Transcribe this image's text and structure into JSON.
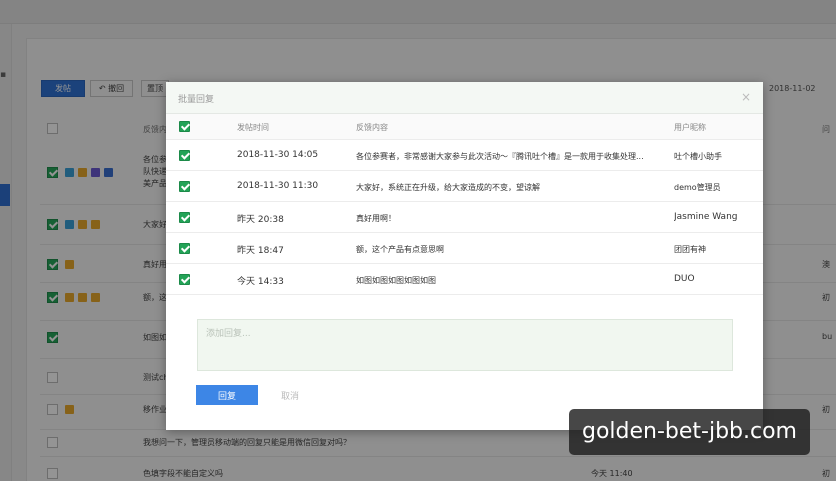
{
  "background": {
    "toolbar": {
      "btn_primary": "发帖",
      "btn_undo": "撤回",
      "btn_other": "置顶",
      "date": "2018-11-02"
    },
    "columns": [
      "反馈内",
      "问"
    ],
    "rows": [
      {
        "text": "各位参\n队快递\n美产品",
        "checked": true
      },
      {
        "text": "大家好",
        "checked": true
      },
      {
        "text": "真好用",
        "checked": true,
        "right": "澳"
      },
      {
        "text": "额，这",
        "checked": true,
        "right": "初"
      },
      {
        "text": "如图如",
        "checked": true,
        "right": "bu"
      },
      {
        "text": "测试ch",
        "checked": false
      },
      {
        "text": "移作业",
        "checked": false,
        "right": "初"
      },
      {
        "text": "我想问一下，管理员移动端的回复只能是用微信回复对吗？",
        "checked": false
      },
      {
        "text": "色填字段不能自定义吗",
        "checked": false,
        "time": "今天 11:40",
        "right": "初"
      }
    ]
  },
  "modal": {
    "title": "批量回复",
    "close_glyph": "×",
    "columns": {
      "time": "发帖时间",
      "content": "反馈内容",
      "user": "用户昵称"
    },
    "rows": [
      {
        "time": "2018-11-30 14:05",
        "content": "各位参赛者，非常感谢大家参与此次活动～『腾讯吐个槽』是一款用于收集处理...",
        "user": "吐个槽小助手"
      },
      {
        "time": "2018-11-30 11:30",
        "content": "大家好，系统正在升级，给大家造成的不变，望谅解",
        "user": "demo管理员"
      },
      {
        "time": "昨天 20:38",
        "content": "真好用啊！",
        "user": "Jasmine Wang"
      },
      {
        "time": "昨天 18:47",
        "content": "额，这个产品有点意思啊",
        "user": "团团有神"
      },
      {
        "time": "今天 14:33",
        "content": "如图如图如图如图如图",
        "user": "DUO"
      }
    ],
    "reply_placeholder": "添加回复...",
    "reply_value": "",
    "btn_reply": "回复",
    "btn_cancel": "取消"
  },
  "watermark": "golden-bet-jbb.com",
  "colors": {
    "accent": "#3d86e6",
    "check_green": "#23a357",
    "reply_bg": "#f1f7f0"
  }
}
